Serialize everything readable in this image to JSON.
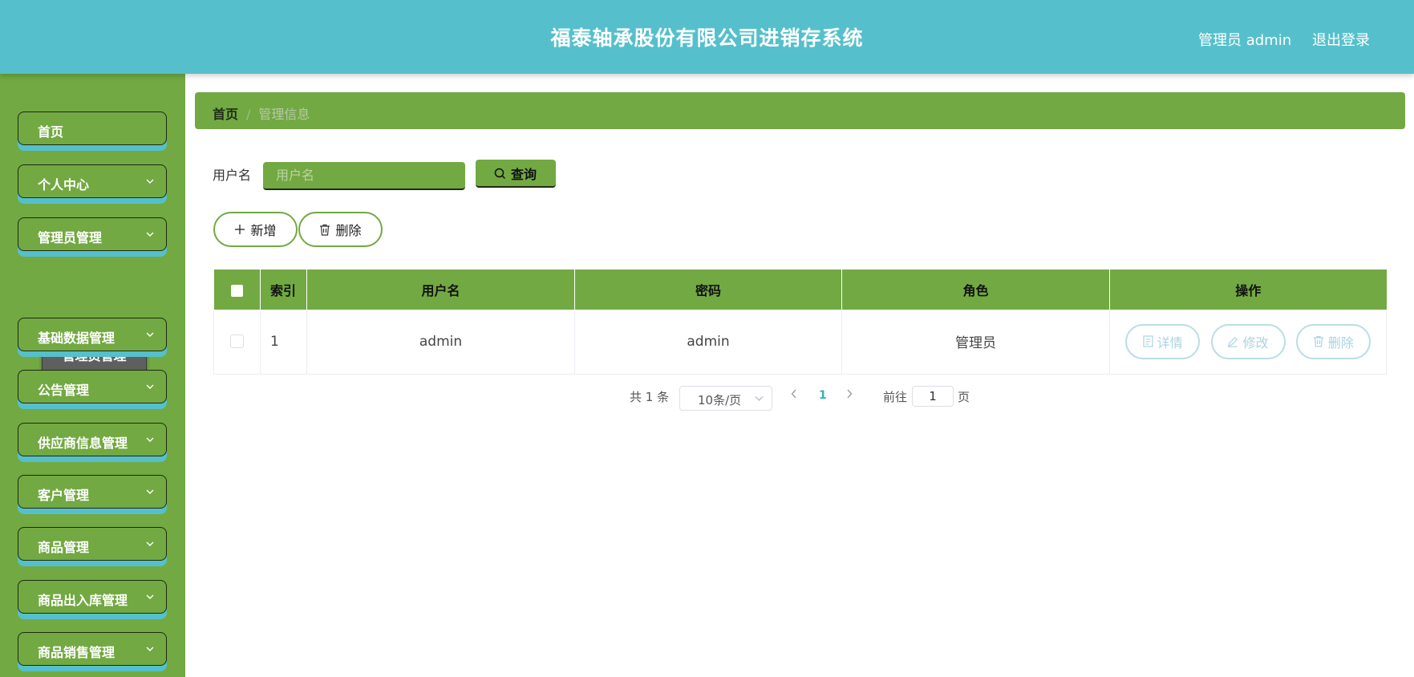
{
  "header": {
    "title": "福泰轴承股份有限公司进销存系统",
    "user_label": "管理员 admin",
    "logout_label": "退出登录"
  },
  "sidebar": {
    "items": [
      {
        "label": "首页",
        "expandable": false
      },
      {
        "label": "个人中心",
        "expandable": true
      },
      {
        "label": "管理员管理",
        "expandable": true,
        "expanded": true
      },
      {
        "label": "基础数据管理",
        "expandable": true
      },
      {
        "label": "公告管理",
        "expandable": true
      },
      {
        "label": "供应商信息管理",
        "expandable": true
      },
      {
        "label": "客户管理",
        "expandable": true
      },
      {
        "label": "商品管理",
        "expandable": true
      },
      {
        "label": "商品出入库管理",
        "expandable": true
      },
      {
        "label": "商品销售管理",
        "expandable": true
      }
    ],
    "submenu": {
      "label": "管理员管理"
    }
  },
  "breadcrumb": {
    "home": "首页",
    "separator": "/",
    "current": "管理信息"
  },
  "search": {
    "label": "用户名",
    "placeholder": "用户名",
    "value": "",
    "button_label": "查询"
  },
  "actions": {
    "add_label": "新增",
    "delete_label": "删除"
  },
  "table": {
    "columns": [
      "索引",
      "用户名",
      "密码",
      "角色",
      "操作"
    ],
    "rows": [
      {
        "index": "1",
        "username": "admin",
        "password": "admin",
        "role": "管理员"
      }
    ],
    "row_actions": {
      "detail": "详情",
      "edit": "修改",
      "delete": "删除"
    }
  },
  "pagination": {
    "total_text": "共 1 条",
    "page_size": "10条/页",
    "current_page": "1",
    "goto_label": "前往",
    "goto_value": "1",
    "page_unit": "页"
  },
  "colors": {
    "header_bg": "#55c0cc",
    "accent_green": "#72a942",
    "submenu_bg": "#5f5f5f",
    "row_button_border": "#b9dde6",
    "active_page": "#2fb5b5"
  },
  "icons": {
    "search": "search-icon",
    "add": "plus-icon",
    "delete": "trash-icon",
    "detail": "document-icon",
    "edit": "pencil-icon",
    "expand": "chevron-down-icon"
  }
}
